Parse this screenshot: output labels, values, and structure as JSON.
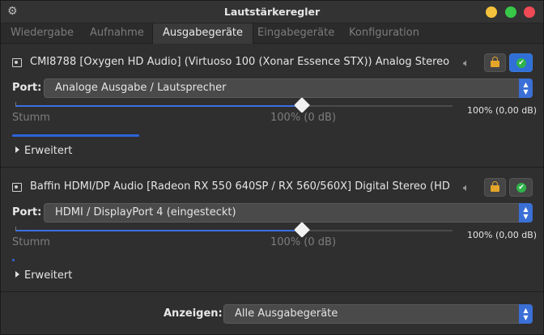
{
  "window": {
    "title": "Lautstärkeregler",
    "icons": {
      "menu": "gear-icon",
      "minimize": "minimize-icon",
      "maximize": "maximize-icon",
      "close": "close-icon"
    },
    "colors": {
      "minimize": "#f4c23b",
      "maximize": "#37c848",
      "close": "#ef4a55"
    }
  },
  "tabs": [
    {
      "label": "Wiedergabe",
      "active": false
    },
    {
      "label": "Aufnahme",
      "active": false
    },
    {
      "label": "Ausgabegeräte",
      "active": true
    },
    {
      "label": "Eingabegeräte",
      "active": false
    },
    {
      "label": "Konfiguration",
      "active": false
    }
  ],
  "devices": [
    {
      "name": "CMI8788 [Oxygen HD Audio] (Virtuoso 100 (Xonar Essence STX)) Analog Stereo",
      "port_label": "Port:",
      "port_value": "Analoge Ausgabe / Lautsprecher",
      "volume_readout": "100% (0,00 dB)",
      "volume_fraction": 0.655,
      "mute_label": "Stumm",
      "zero_label": "100% (0 dB)",
      "peak_level_fraction": 0.29,
      "expander_label": "Erweitert",
      "locked": true,
      "muted": false
    },
    {
      "name": "Baffin HDMI/DP Audio [Radeon RX 550 640SP / RX 560/560X] Digital Stereo (HD...",
      "port_label": "Port:",
      "port_value": "HDMI / DisplayPort 4 (eingesteckt)",
      "volume_readout": "100% (0,00 dB)",
      "volume_fraction": 0.655,
      "mute_label": "Stumm",
      "zero_label": "100% (0 dB)",
      "peak_level_fraction": 0.005,
      "expander_label": "Erweitert",
      "locked": true,
      "muted": false
    }
  ],
  "footer": {
    "show_label": "Anzeigen:",
    "show_value": "Alle Ausgabegeräte"
  },
  "colors": {
    "accent": "#3c6fe0",
    "lock": "#e5a52a",
    "check": "#2fb34a"
  }
}
